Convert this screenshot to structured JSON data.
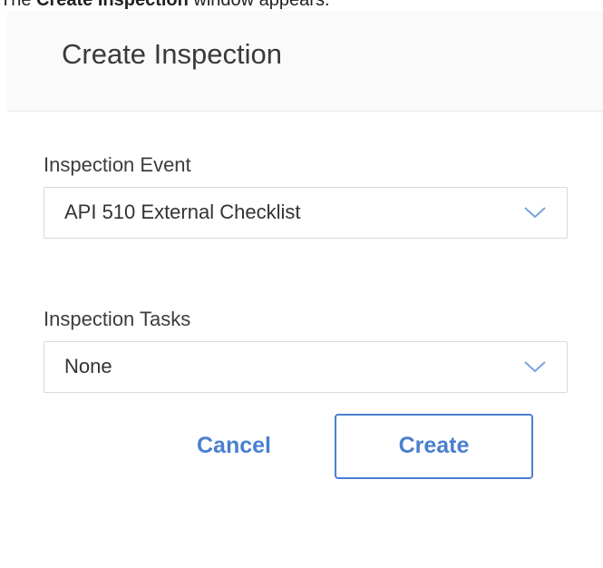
{
  "caption": {
    "prefix": "The ",
    "bold": "Create Inspection",
    "suffix": " window appears."
  },
  "dialog": {
    "title": "Create Inspection",
    "fields": [
      {
        "label": "Inspection Event",
        "value": "API 510 External Checklist",
        "icon": "chevron-down-icon"
      },
      {
        "label": "Inspection Tasks",
        "value": "None",
        "icon": "chevron-down-icon"
      }
    ],
    "buttons": {
      "cancel_label": "Cancel",
      "create_label": "Create"
    }
  },
  "colors": {
    "accent": "#4a7fd0",
    "header_bg": "#fafafa",
    "border": "#d9d9d9"
  }
}
